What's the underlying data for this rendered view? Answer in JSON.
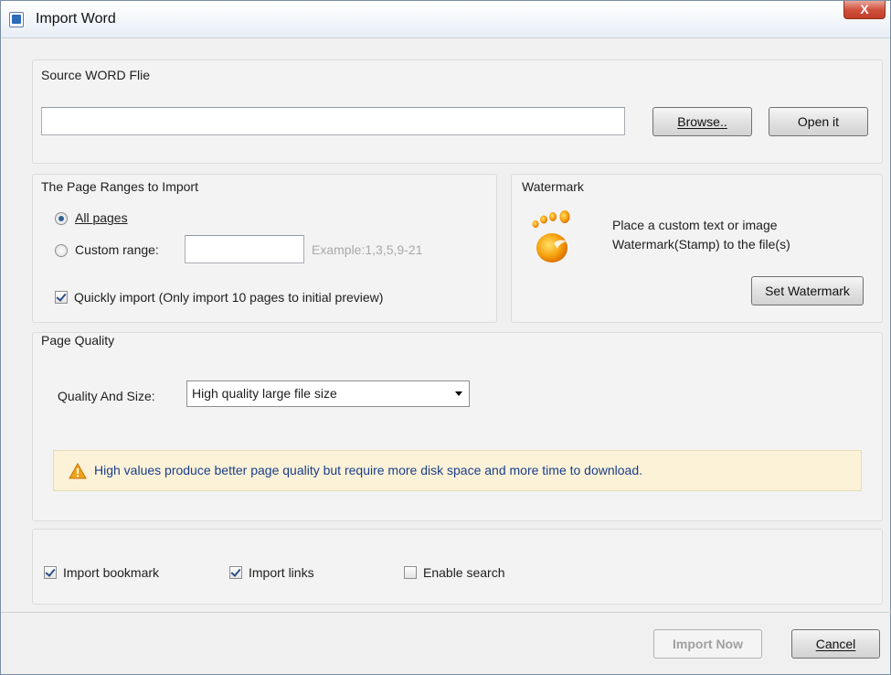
{
  "window": {
    "title": "Import Word",
    "close_label": "X"
  },
  "source": {
    "group_title": "Source WORD Flie",
    "path_value": "",
    "browse_label": "Browse..",
    "open_label": "Open it"
  },
  "ranges": {
    "group_title": "The Page Ranges to Import",
    "all_pages_label": "All pages",
    "all_pages_checked": true,
    "custom_label": "Custom range:",
    "custom_value": "",
    "example_text": "Example:1,3,5,9-21",
    "quick_import_label": "Quickly import (Only import 10 pages to  initial  preview)",
    "quick_import_checked": true
  },
  "watermark": {
    "group_title": "Watermark",
    "description_line1": "Place a custom text or image",
    "description_line2": "Watermark(Stamp) to the file(s)",
    "button_label": "Set Watermark",
    "icon": "footprint-icon"
  },
  "quality": {
    "group_title": "Page Quality",
    "field_label": "Quality And Size:",
    "selected_option": "High quality large file size",
    "warning_text": "High values produce better page quality but require more disk space and more time to download."
  },
  "options": {
    "import_bookmark_label": "Import bookmark",
    "import_bookmark_checked": true,
    "import_links_label": "Import links",
    "import_links_checked": true,
    "enable_search_label": "Enable search",
    "enable_search_checked": false
  },
  "footer": {
    "import_now_label": "Import Now",
    "cancel_label": "Cancel"
  },
  "colors": {
    "accent_text": "#1b3e8a",
    "warning_bg": "#fbf2d8",
    "close_red": "#c23c27"
  }
}
